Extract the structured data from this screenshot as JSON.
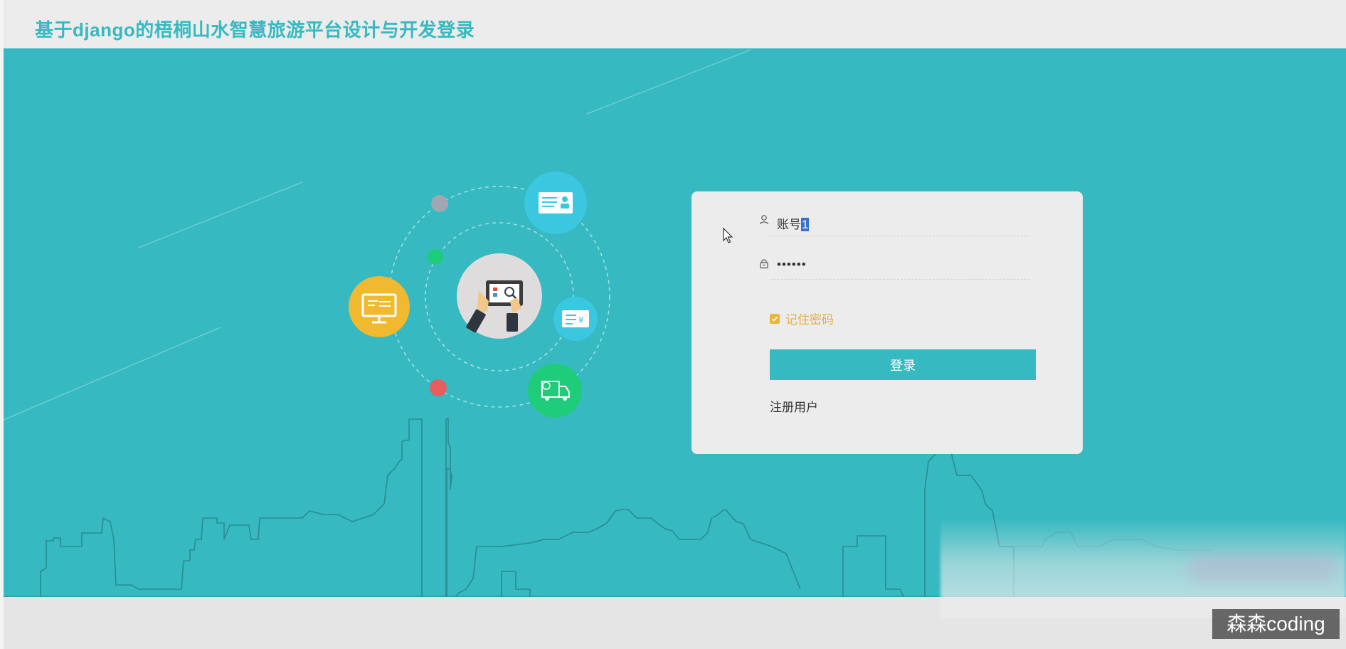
{
  "header": {
    "title": "基于django的梧桐山水智慧旅游平台设计与开发登录"
  },
  "login": {
    "account_label": "账号",
    "account_value": "1",
    "password_value": "••••••",
    "remember_label": "记住密码",
    "remember_checked": true,
    "submit_label": "登录",
    "register_label": "注册用户"
  },
  "watermark": {
    "text": "森森coding"
  },
  "colors": {
    "primary": "#36b9c1",
    "accent": "#e2b13a",
    "card": "#ececec",
    "icon_yellow": "#f0b92f",
    "icon_green": "#1fcc7a",
    "icon_red": "#e85d5d",
    "icon_cyan": "#3bc7e0"
  },
  "icons": {
    "user": "user-icon",
    "lock": "lock-icon",
    "check": "check-icon",
    "tablet": "tablet-search-icon",
    "monitor": "monitor-icon",
    "id_card": "id-card-icon",
    "payment_card": "payment-card-icon",
    "truck": "delivery-truck-icon"
  }
}
